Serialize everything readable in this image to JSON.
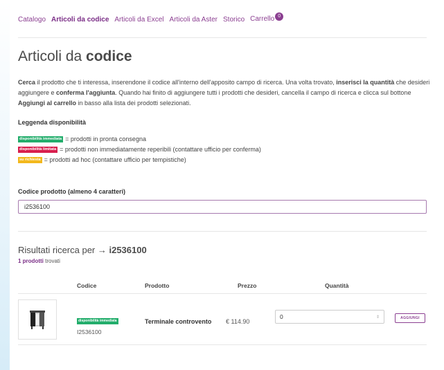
{
  "nav": {
    "items": [
      {
        "label": "Catalogo"
      },
      {
        "label": "Articoli da codice"
      },
      {
        "label": "Articoli da Excel"
      },
      {
        "label": "Articoli da Aster"
      },
      {
        "label": "Storico"
      },
      {
        "label": "Carrello"
      }
    ],
    "cart_count": "0"
  },
  "page": {
    "title_light": "Articoli da ",
    "title_bold": "codice"
  },
  "intro": {
    "p1": "Cerca",
    "p2": " il prodotto che ti interessa, inserendone il codice all'interno dell'apposito campo di ricerca. Una volta trovato, ",
    "p3": "inserisci la quantità",
    "p4": " che desideri aggiungere e ",
    "p5": "conferma l'aggiunta",
    "p6": ". Quando hai finito di aggiungere tutti i prodotti che desideri, cancella il campo di ricerca e clicca sul bottone ",
    "p7": "Aggiungi al carrello",
    "p8": " in basso alla lista dei prodotti selezionati."
  },
  "legend": {
    "title": "Leggenda disponibilità",
    "items": [
      {
        "chip": "disponibilità immediata",
        "text": "= prodotti in pronta consegna"
      },
      {
        "chip": "disponibilità limitata",
        "text": "= prodotti non immediatamente reperibili (contattare ufficio per conferma)"
      },
      {
        "chip": "su richiesta",
        "text": "= prodotti ad hoc (contattare ufficio per tempistiche)"
      }
    ]
  },
  "search": {
    "label": "Codice prodotto (almeno 4 caratteri)",
    "value": "i2536100"
  },
  "results": {
    "prefix": "Risultati ricerca per → ",
    "query": "i2536100",
    "count": "1 prodotti",
    "count_suffix": " trovati"
  },
  "table": {
    "headers": [
      "Codice",
      "Prodotto",
      "Prezzo",
      "Quantità"
    ],
    "rows": [
      {
        "availability": "disponibilità immediata",
        "code": "I2536100",
        "product": "Terminale controvento",
        "price": "€ 114.90",
        "quantity": "0",
        "add_label": "AGGIUNGI"
      }
    ]
  },
  "colors": {
    "accent": "#8b3f91",
    "available": "#22ad6b",
    "limited": "#d81e4d",
    "on_request": "#f3b81c"
  }
}
